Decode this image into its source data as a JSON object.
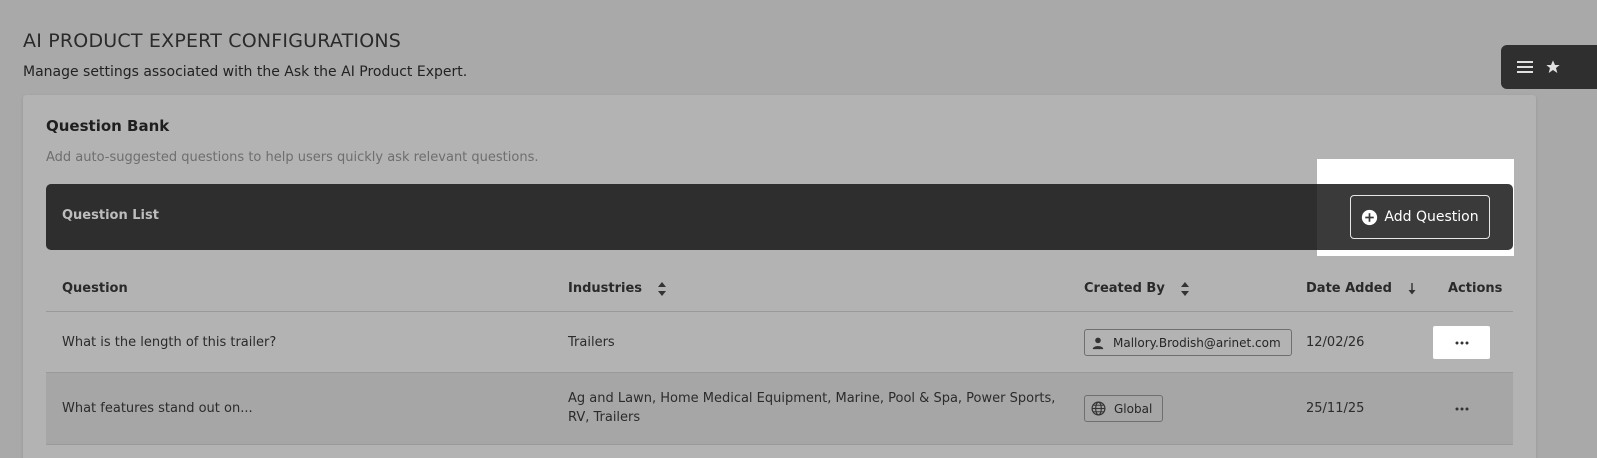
{
  "page": {
    "title": "AI PRODUCT EXPERT CONFIGURATIONS",
    "subtitle": "Manage settings associated with the Ask the AI Product Expert."
  },
  "floating_tab": {
    "icons": [
      "menu-icon",
      "star-icon"
    ]
  },
  "card": {
    "title": "Question Bank",
    "description": "Add auto-suggested questions to help users quickly ask relevant questions."
  },
  "list_bar": {
    "label": "Question List",
    "add_button_label": "Add Question",
    "add_button_icon": "plus-circle-icon"
  },
  "table": {
    "columns": [
      {
        "label": "Question",
        "sort": "none"
      },
      {
        "label": "Industries",
        "sort": "unsorted"
      },
      {
        "label": "Created By",
        "sort": "unsorted"
      },
      {
        "label": "Date Added",
        "sort": "descending"
      },
      {
        "label": "Actions",
        "sort": "none"
      }
    ],
    "rows": [
      {
        "question": "What is the length of this trailer?",
        "industries": "Trailers",
        "created_by": "Mallory.Brodish@arinet.com",
        "created_by_icon": "person-icon",
        "date_added": "12/02/26",
        "action_icon": "more-horizontal-icon"
      },
      {
        "question": "What features stand out on...",
        "industries": "Ag and Lawn, Home Medical Equipment, Marine, Pool & Spa, Power Sports, RV, Trailers",
        "created_by": "Global",
        "created_by_icon": "globe-icon",
        "date_added": "25/11/25",
        "action_icon": "more-horizontal-icon"
      }
    ]
  },
  "colors": {
    "overlay_background": "#a9a9a9",
    "dark_bar": "#2e2e2e",
    "highlight": "#ffffff"
  }
}
